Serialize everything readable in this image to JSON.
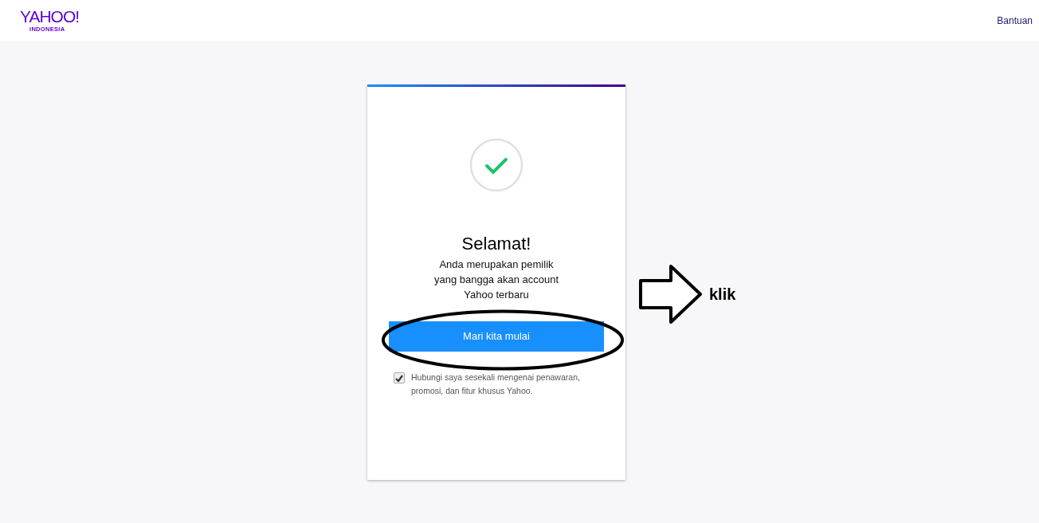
{
  "header": {
    "logo": "YAHOO!",
    "logo_sub": "INDONESIA",
    "help_link": "Bantuan"
  },
  "card": {
    "title": "Selamat!",
    "message_lines": [
      "Anda merupakan pemilik",
      "yang bangga akan account",
      "Yahoo terbaru"
    ],
    "button": "Mari kita mulai",
    "consent": {
      "checked": true,
      "text": "Hubungi saya sesekali mengenai penawaran, promosi, dan fitur khusus Yahoo."
    }
  },
  "annotation": {
    "label": "klik"
  }
}
